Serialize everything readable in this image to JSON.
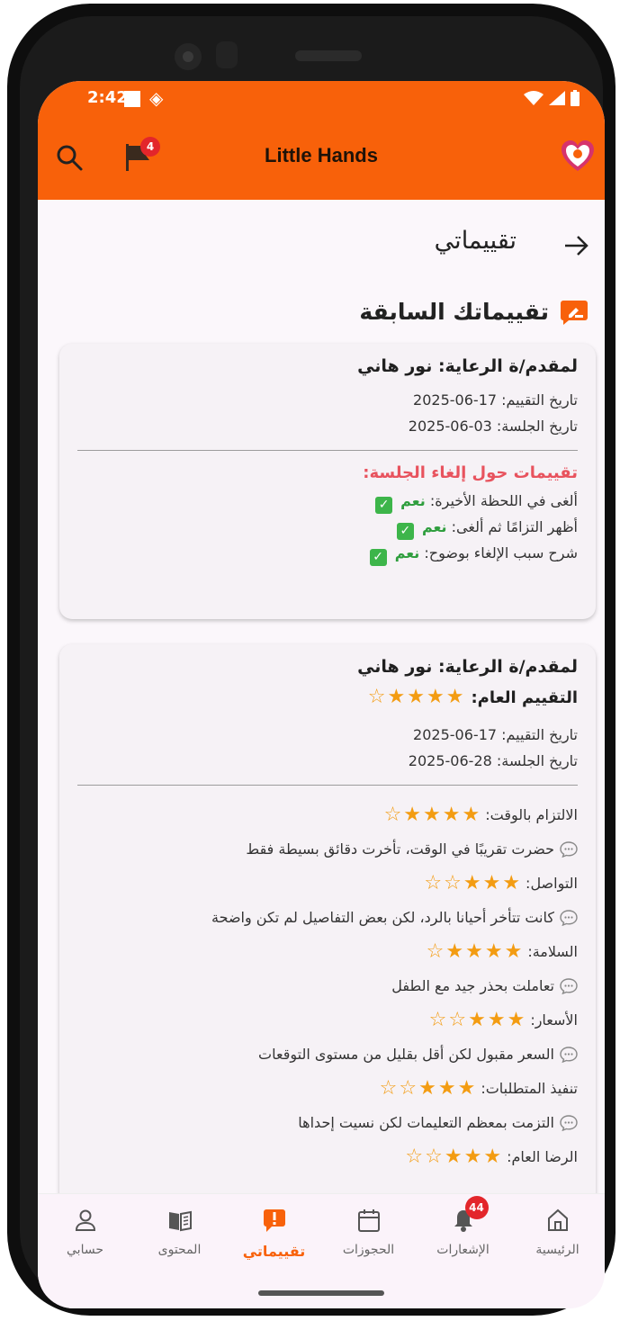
{
  "status_bar": {
    "time": "2:42"
  },
  "app": {
    "title": "Little Hands",
    "report_badge": "4"
  },
  "page": {
    "title": "تقييماتي",
    "section_title": "تقييماتك السابقة"
  },
  "card1": {
    "provider": "لمقدم/ة الرعاية: نور هاني",
    "rating_date": "تاريخ التقييم: 17-06-2025",
    "session_date": "تاريخ الجلسة: 03-06-2025",
    "cancel_title": "تقييمات حول إلغاء الجلسة:",
    "items": [
      {
        "label": "ألغى في اللحظة الأخيرة:",
        "value": "نعم"
      },
      {
        "label": "أظهر التزامًا ثم ألغى:",
        "value": "نعم"
      },
      {
        "label": "شرح سبب الإلغاء بوضوح:",
        "value": "نعم"
      }
    ]
  },
  "card2": {
    "provider": "لمقدم/ة الرعاية: نور هاني",
    "overall_label": "التقييم العام:",
    "overall_stars": 4,
    "rating_date": "تاريخ التقييم: 17-06-2025",
    "session_date": "تاريخ الجلسة: 28-06-2025",
    "criteria": [
      {
        "label": "الالتزام بالوقت:",
        "stars": 4,
        "comment": "حضرت تقريبًا في الوقت، تأخرت دقائق بسيطة فقط"
      },
      {
        "label": "التواصل:",
        "stars": 3,
        "comment": "كانت تتأخر أحيانا بالرد، لكن بعض التفاصيل لم تكن واضحة"
      },
      {
        "label": "السلامة:",
        "stars": 4,
        "comment": "تعاملت بحذر جيد مع الطفل"
      },
      {
        "label": "الأسعار:",
        "stars": 3,
        "comment": "السعر مقبول لكن أقل بقليل من مستوى التوقعات"
      },
      {
        "label": "تنفيذ المتطلبات:",
        "stars": 3,
        "comment": "التزمت بمعظم التعليمات لكن نسيت إحداها"
      },
      {
        "label": "الرضا العام:",
        "stars": 3,
        "comment": ""
      }
    ]
  },
  "bottom_nav": {
    "home": "الرئيسية",
    "notifications": "الإشعارات",
    "notifications_badge": "44",
    "bookings": "الحجوزات",
    "ratings": "تقييماتي",
    "content": "المحتوى",
    "account": "حسابي"
  },
  "colors": {
    "primary": "#f8610a",
    "star": "#f39c12",
    "yes": "#2f9e3e",
    "cancel_title": "#e8535e"
  }
}
